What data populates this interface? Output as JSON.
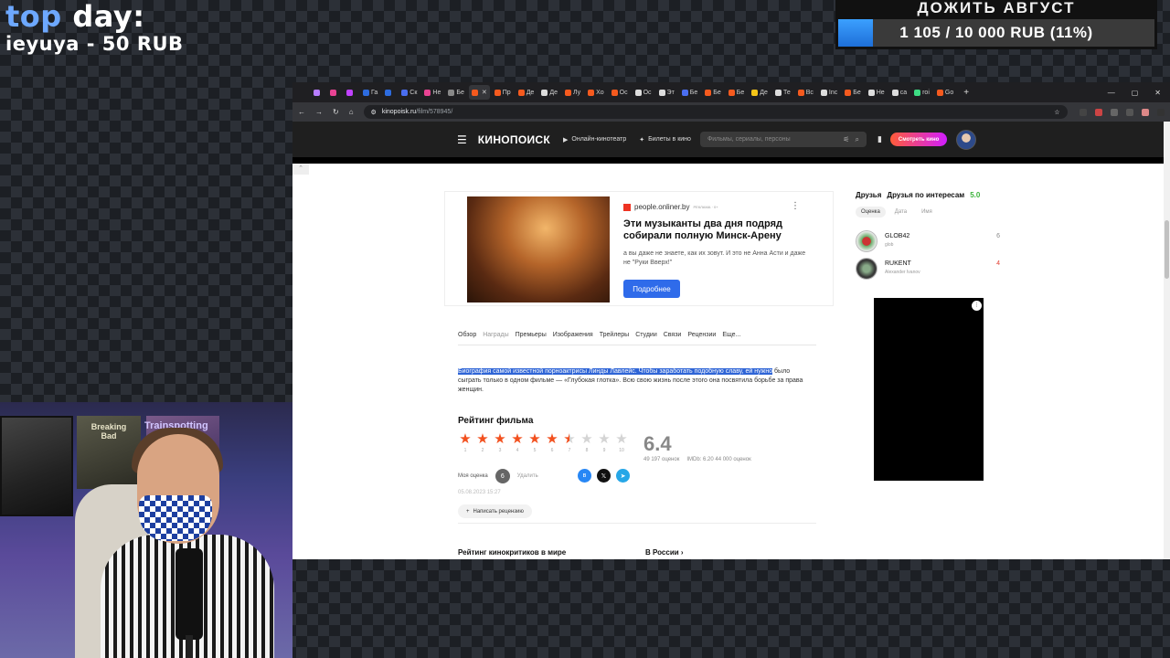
{
  "overlay": {
    "top_day_title_1": "top ",
    "top_day_title_2": "day:",
    "top_day_entry": "ieyuya - 50 RUB",
    "goal_title": "ДОЖИТЬ АВГУСТ",
    "goal_text": "1 105 / 10 000 RUB (11%)",
    "goal_progress": 0.11
  },
  "browser": {
    "tabs": [
      {
        "label": "",
        "color": "#b77dff"
      },
      {
        "label": "",
        "color": "#e84393"
      },
      {
        "label": "",
        "color": "#c042ff"
      },
      {
        "label": "Га",
        "color": "#2d6cdf"
      },
      {
        "label": "",
        "color": "#2d6cdf"
      },
      {
        "label": "Ск",
        "color": "#4a6ef0"
      },
      {
        "label": "Не",
        "color": "#e84393"
      },
      {
        "label": "Бе",
        "color": "#888888"
      },
      {
        "label": "",
        "color": "#f55a1e",
        "active": true
      },
      {
        "label": "Пр",
        "color": "#f55a1e"
      },
      {
        "label": "Де",
        "color": "#f55a1e"
      },
      {
        "label": "Де",
        "color": "#dddddd"
      },
      {
        "label": "Лу",
        "color": "#f55a1e"
      },
      {
        "label": "Хо",
        "color": "#f55a1e"
      },
      {
        "label": "Ос",
        "color": "#f55a1e"
      },
      {
        "label": "Ос",
        "color": "#dddddd"
      },
      {
        "label": "Эт",
        "color": "#dddddd"
      },
      {
        "label": "Бе",
        "color": "#4a6ef0"
      },
      {
        "label": "Бе",
        "color": "#f55a1e"
      },
      {
        "label": "Бе",
        "color": "#f55a1e"
      },
      {
        "label": "Де",
        "color": "#f5c518"
      },
      {
        "label": "Те",
        "color": "#dddddd"
      },
      {
        "label": "Вс",
        "color": "#f55a1e"
      },
      {
        "label": "Inc",
        "color": "#dddddd"
      },
      {
        "label": "Бе",
        "color": "#f55a1e"
      },
      {
        "label": "Не",
        "color": "#dddddd"
      },
      {
        "label": "са",
        "color": "#dddddd"
      },
      {
        "label": "roi",
        "color": "#3ddc84"
      },
      {
        "label": "Go",
        "color": "#f55a1e"
      }
    ],
    "new_tab": "+",
    "url_host": "kinopoisk.ru",
    "url_path": "/film/578945/"
  },
  "kp": {
    "logo": "КИНОПОИСК",
    "nav_cinema": "Онлайн-кинотеатр",
    "nav_tickets": "Билеты в кино",
    "search_placeholder": "Фильмы, сериалы, персоны",
    "watch_button": "Смотреть кино"
  },
  "ad": {
    "source": "people.onliner.by",
    "source_tag": "РЕКЛАМА · 0+",
    "headline": "Эти музыканты два дня подряд собирали полную Минск-Арену",
    "description": "а вы даже не знаете, как их зовут. И это не Анна Асти и даже не \"Руки Вверх!\"",
    "button": "Подробнее"
  },
  "film_tabs": [
    "Обзор",
    "Награды",
    "Премьеры",
    "Изображения",
    "Трейлеры",
    "Студии",
    "Связи",
    "Рецензии",
    "Еще..."
  ],
  "synopsis": {
    "highlighted": "Биография самой известной порноактрисы Линды Лавлейс. Чтобы заработать подобную славу, ей нужно",
    "rest": " было сыграть только в одном фильме — «Глубокая глотка». Всю свою жизнь после этого она посвятила борьбе за права женщин."
  },
  "rating": {
    "title": "Рейтинг фильма",
    "stars_filled": 6.5,
    "star_numbers": [
      "1",
      "2",
      "3",
      "4",
      "5",
      "6",
      "7",
      "8",
      "9",
      "10"
    ],
    "score": "6.4",
    "votes": "49 197 оценок",
    "imdb": "IMDb: 6.20",
    "imdb_votes": "44 000 оценок",
    "my_rating_label": "Моя оценка",
    "my_rating": "6",
    "delete": "Удалить",
    "date": "05.08.2023 15:27",
    "write_review": "Написать рецензию",
    "critics_world": "Рейтинг кинокритиков в мире",
    "critics_russia": "В России"
  },
  "friends": {
    "title": "Друзья",
    "by_interests": "Друзья по интересам",
    "interest_score": "5.0",
    "sort": [
      "Оценка",
      "Дата",
      "Имя"
    ],
    "list": [
      {
        "name": "GLOB42",
        "sub": "glob",
        "score": "6",
        "score_color": "gray"
      },
      {
        "name": "RUKENT",
        "sub": "Alexander Ivanov",
        "score": "4",
        "score_color": "red"
      }
    ]
  },
  "webcam": {
    "poster_breaking": "Breaking Bad",
    "poster_train": "Trainspotting"
  }
}
